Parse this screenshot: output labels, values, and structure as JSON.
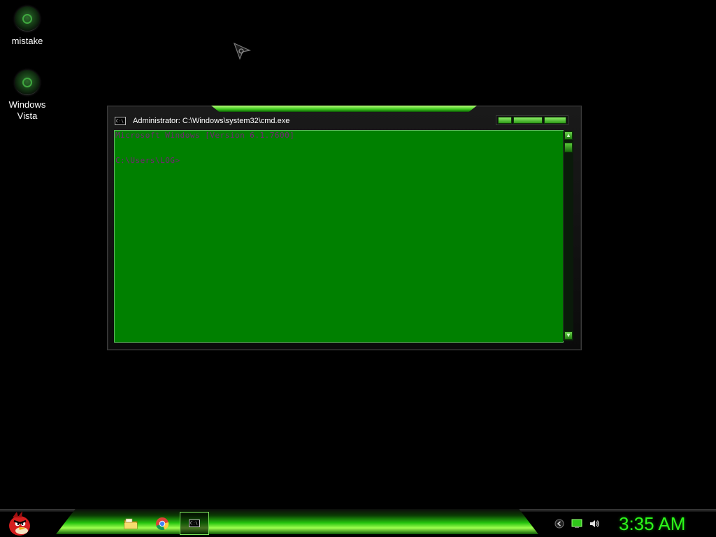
{
  "desktop": {
    "icons": [
      {
        "label": "mistake",
        "icon": "green-orb-icon"
      },
      {
        "label": "Windows\nVista",
        "icon": "green-recycle-orb-icon"
      }
    ]
  },
  "cmd_window": {
    "title": "Administrator: C:\\Windows\\system32\\cmd.exe",
    "icon_text": "C:\\",
    "console_lines": [
      "Microsoft Windows [Version 6.1.7600]",
      "",
      "C:\\Users\\LOG>"
    ],
    "colors": {
      "console_bg": "#008000",
      "console_text": "#7a1f7a"
    }
  },
  "taskbar": {
    "start_icon": "angry-bird-start-icon",
    "apps": [
      {
        "name": "file-explorer",
        "icon": "folder-icon"
      },
      {
        "name": "google-chrome",
        "icon": "chrome-icon"
      },
      {
        "name": "command-prompt",
        "icon": "cmd-icon",
        "active": true,
        "icon_text": "C:\\"
      }
    ],
    "tray": [
      "up-arrow-icon",
      "network-icon",
      "volume-icon"
    ],
    "clock": "3:35 AM"
  }
}
